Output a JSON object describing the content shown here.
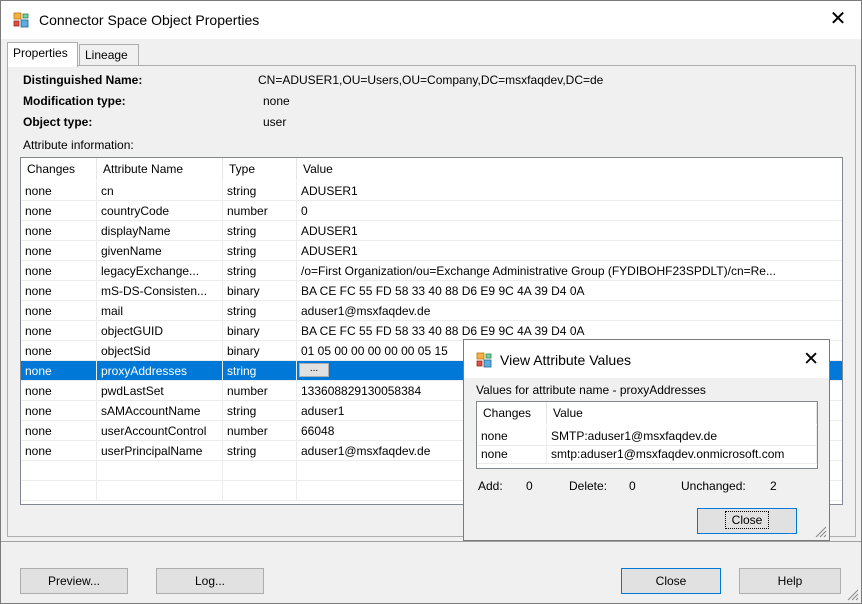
{
  "window": {
    "title": "Connector Space Object Properties",
    "close_glyph": "✕"
  },
  "tabs": [
    {
      "label": "Properties"
    },
    {
      "label": "Lineage"
    }
  ],
  "object": {
    "dn_label": "Distinguished Name:",
    "dn_value": "CN=ADUSER1,OU=Users,OU=Company,DC=msxfaqdev,DC=de",
    "modtype_label": "Modification type:",
    "modtype_value": "none",
    "objtype_label": "Object type:",
    "objtype_value": "user"
  },
  "attribute_info_label": "Attribute information:",
  "grid": {
    "columns": [
      "Changes",
      "Attribute Name",
      "Type",
      "Value"
    ],
    "rows": [
      [
        "none",
        "cn",
        "string",
        "ADUSER1"
      ],
      [
        "none",
        "countryCode",
        "number",
        "0"
      ],
      [
        "none",
        "displayName",
        "string",
        "ADUSER1"
      ],
      [
        "none",
        "givenName",
        "string",
        "ADUSER1"
      ],
      [
        "none",
        "legacyExchange...",
        "string",
        "/o=First Organization/ou=Exchange Administrative Group (FYDIBOHF23SPDLT)/cn=Re..."
      ],
      [
        "none",
        "mS-DS-Consisten...",
        "binary",
        "BA CE FC 55 FD 58 33 40 88 D6 E9 9C 4A 39 D4 0A"
      ],
      [
        "none",
        "mail",
        "string",
        "aduser1@msxfaqdev.de"
      ],
      [
        "none",
        "objectGUID",
        "binary",
        "BA CE FC 55 FD 58 33 40 88 D6 E9 9C 4A 39 D4 0A"
      ],
      [
        "none",
        "objectSid",
        "binary",
        "01 05 00 00 00 00 00 05 15"
      ],
      [
        "none",
        "proxyAddresses",
        "string",
        ""
      ],
      [
        "none",
        "pwdLastSet",
        "number",
        "133608829130058384"
      ],
      [
        "none",
        "sAMAccountName",
        "string",
        "aduser1"
      ],
      [
        "none",
        "userAccountControl",
        "number",
        "66048"
      ],
      [
        "none",
        "userPrincipalName",
        "string",
        "aduser1@msxfaqdev.de"
      ]
    ],
    "selected_row_attribute": "proxyAddresses",
    "ellipsis_label": "..."
  },
  "buttons": {
    "preview": "Preview...",
    "log": "Log...",
    "close": "Close",
    "help": "Help"
  },
  "popup": {
    "title": "View Attribute Values",
    "close_glyph": "✕",
    "caption": "Values for attribute name - proxyAddresses",
    "columns": [
      "Changes",
      "Value"
    ],
    "rows": [
      [
        "none",
        "SMTP:aduser1@msxfaqdev.de"
      ],
      [
        "none",
        "smtp:aduser1@msxfaqdev.onmicrosoft.com"
      ]
    ],
    "add_label": "Add:",
    "add_value": "0",
    "delete_label": "Delete:",
    "delete_value": "0",
    "unchanged_label": "Unchanged:",
    "unchanged_value": "2",
    "close_button": "Close"
  },
  "colors": {
    "selection": "#0078d7",
    "window_bg": "#f0f0f0",
    "focus_border": "#0078d7"
  }
}
